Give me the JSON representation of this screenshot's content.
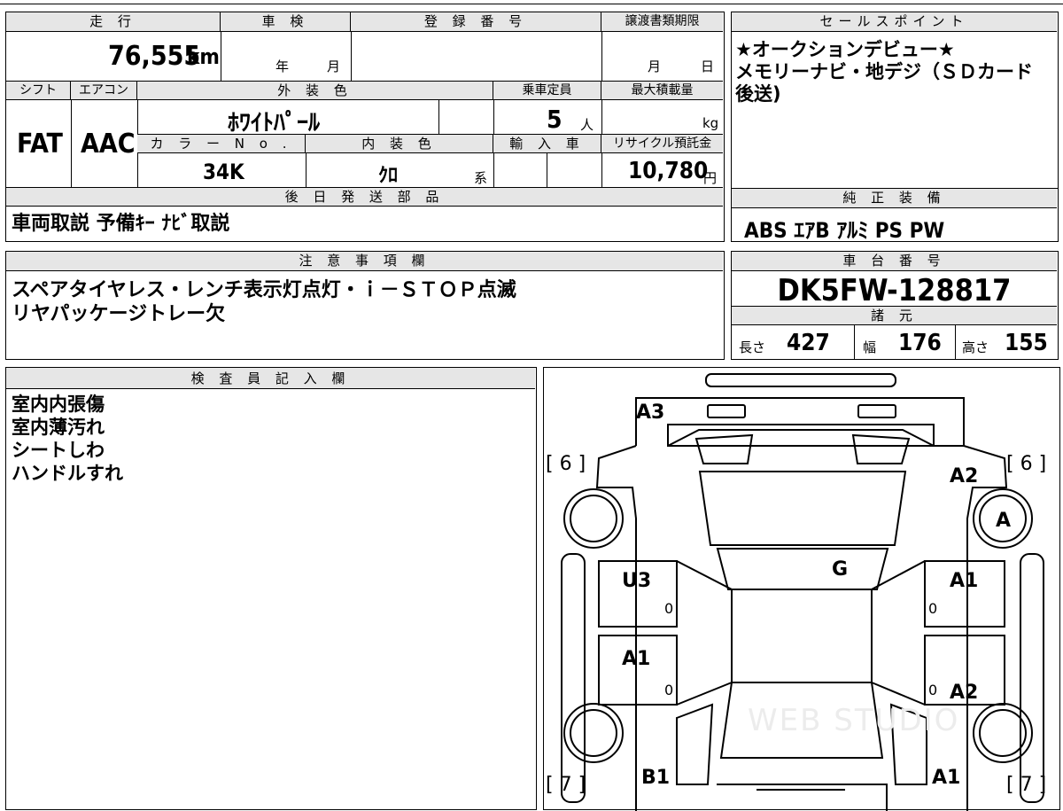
{
  "vehicle": {
    "headers": {
      "mileage": "走 行",
      "inspection": "車 検",
      "registration": "登 録 番 号",
      "transfer_deadline": "譲渡書類期限",
      "shift": "シフト",
      "aircon": "エアコン",
      "exterior_color": "外 装 色",
      "capacity": "乗車定員",
      "max_load": "最大積載量",
      "color_no": "カ ラ ー N o .",
      "interior_color": "内 装 色",
      "imported": "輸 入 車",
      "recycle_fee": "リサイクル預託金",
      "later_parts": "後 日 発 送 部 品"
    },
    "mileage": "76,555",
    "mileage_unit": "km",
    "inspection_year_unit": "年",
    "inspection_month_unit": "月",
    "transfer_month_unit": "月",
    "transfer_day_unit": "日",
    "shift": "FAT",
    "aircon": "AAC",
    "exterior_color": "ﾎﾜｲﾄﾊﾟｰﾙ",
    "capacity": "5",
    "capacity_unit": "人",
    "max_load_unit": "kg",
    "color_no": "34K",
    "interior_color": "ｸﾛ",
    "interior_color_suffix": "系",
    "recycle_fee": "10,780",
    "recycle_fee_unit": "円",
    "later_parts": "車両取説 予備ｷｰ ﾅﾋﾞ取説"
  },
  "sales": {
    "header": "セールスポイント",
    "text": "★オークションデビュー★\nメモリーナビ・地デジ（ＳＤカード後送)"
  },
  "equipment": {
    "header": "純 正 装 備",
    "text": "ABS ｴｱB ｱﾙﾐ PS PW"
  },
  "caution": {
    "header": "注 意 事 項 欄",
    "text": "スペアタイヤレス・レンチ表示灯点灯・ｉ－ＳＴＯＰ点滅\nリヤパッケージトレー欠"
  },
  "chassis": {
    "header": "車 台 番 号",
    "number": "DK5FW-128817"
  },
  "specs": {
    "header": "諸 元",
    "length_label": "長さ",
    "length": "427",
    "width_label": "幅",
    "width": "176",
    "height_label": "高さ",
    "height": "155"
  },
  "inspector": {
    "header": "検 査 員 記 入 欄",
    "text": "室内内張傷\n室内薄汚れ\nシートしわ\nハンドルすれ"
  },
  "diagram": {
    "labels": {
      "rear": "A3",
      "left_rear_bracket": "[ 6 ]",
      "right_rear_bracket": "[ 6 ]",
      "right_rear_corner": "A2",
      "right_rear_wheel": "A",
      "glass": "G",
      "left_rear_door": "U3",
      "right_rear_door": "A1",
      "left_front_door": "A1",
      "right_front_door": "A2",
      "left_front_fender": "B1",
      "right_front_fender": "A1",
      "left_front_bracket": "[ 7 ]",
      "right_front_bracket": "[ 7 ]",
      "mark_left_rear": "0",
      "mark_right_rear": "0",
      "mark_left_front": "0",
      "mark_right_front": "0"
    },
    "watermark": "WEB STUDIO"
  }
}
